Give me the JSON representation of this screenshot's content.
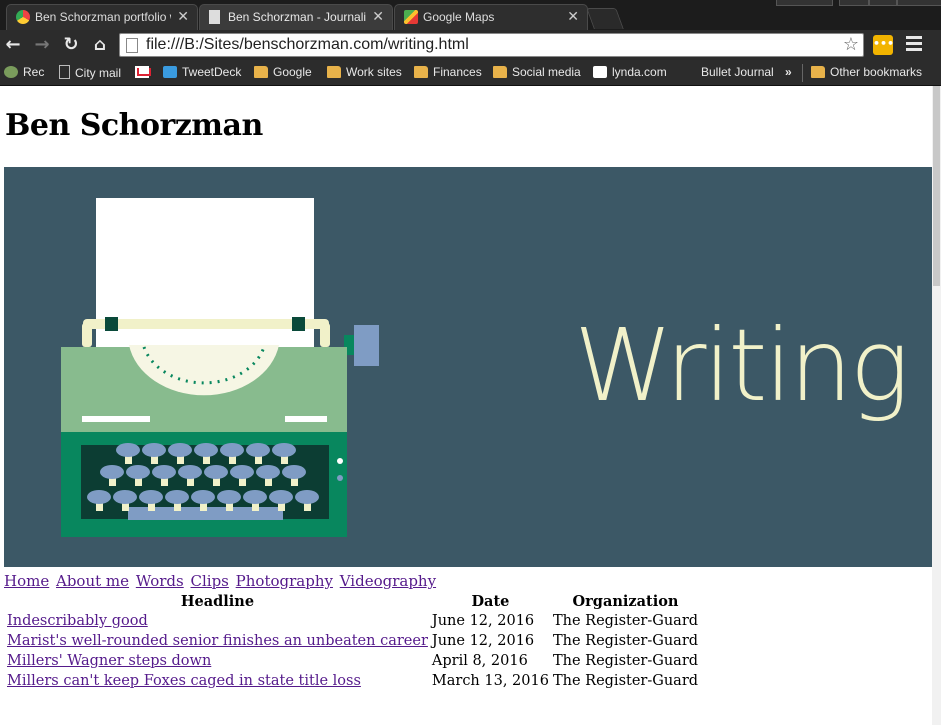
{
  "browser": {
    "tabs": [
      {
        "title": "Ben Schorzman portfolio w",
        "icon": "chrome-favicon"
      },
      {
        "title": "Ben Schorzman - Journalis",
        "icon": "blank-page-favicon"
      },
      {
        "title": "Google Maps",
        "icon": "google-maps-favicon"
      }
    ],
    "close_glyph": "✕",
    "url": "file:///B:/Sites/benschorzman.com/writing.html",
    "bookmarks": [
      {
        "label": "Rec",
        "icon": "rec-icon"
      },
      {
        "label": "City mail",
        "icon": "page-icon"
      },
      {
        "label": "",
        "icon": "gmail-icon"
      },
      {
        "label": "TweetDeck",
        "icon": "tweetdeck-icon"
      },
      {
        "label": "Google",
        "icon": "folder-icon"
      },
      {
        "label": "Work sites",
        "icon": "folder-icon"
      },
      {
        "label": "Finances",
        "icon": "folder-icon"
      },
      {
        "label": "Social media",
        "icon": "folder-icon"
      },
      {
        "label": "lynda.com",
        "icon": "lynda-icon"
      },
      {
        "label": "Bullet Journal",
        "icon": "none"
      },
      {
        "label": "»",
        "icon": "none"
      },
      {
        "label": "Other bookmarks",
        "icon": "folder-icon"
      }
    ]
  },
  "page": {
    "site_title": "Ben Schorzman",
    "hero_title": "Writing",
    "nav": [
      "Home",
      "About me",
      "Words",
      "Clips",
      "Photography",
      "Videography"
    ],
    "table": {
      "headers": [
        "Headline",
        "Date",
        "Organization"
      ],
      "rows": [
        [
          "Indescribably good",
          "June 12, 2016",
          "The Register-Guard"
        ],
        [
          "Marist's well-rounded senior finishes an unbeaten career",
          "June 12, 2016",
          "The Register-Guard"
        ],
        [
          "Millers' Wagner steps down",
          "April 8, 2016",
          "The Register-Guard"
        ],
        [
          "Millers can't keep Foxes caged in state title loss",
          "March 13, 2016",
          "The Register-Guard"
        ]
      ]
    }
  },
  "colors": {
    "hero_background": "#3c5866",
    "hero_text": "#f1f1c9",
    "link_visited": "#551a8b",
    "typewriter_body": "#88bb8e",
    "typewriter_base": "#08875e",
    "typewriter_keys": "#7f9cc4"
  }
}
